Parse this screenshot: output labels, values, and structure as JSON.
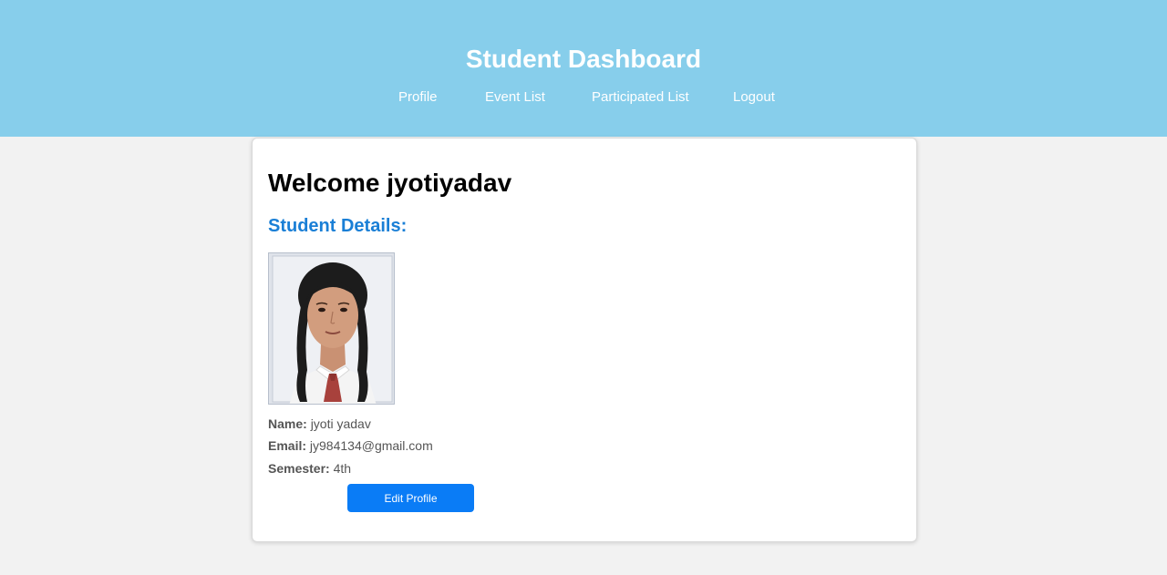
{
  "header": {
    "title": "Student Dashboard",
    "nav": [
      {
        "label": "Profile"
      },
      {
        "label": "Event List"
      },
      {
        "label": "Participated List"
      },
      {
        "label": "Logout"
      }
    ]
  },
  "main": {
    "welcome": "Welcome jyotiyadav",
    "details_heading": "Student Details:",
    "fields": [
      {
        "label": "Name:",
        "value": "jyoti yadav"
      },
      {
        "label": "Email:",
        "value": "jy984134@gmail.com"
      },
      {
        "label": "Semester:",
        "value": "4th"
      }
    ],
    "edit_button": "Edit Profile"
  },
  "colors": {
    "header_bg": "#87ceeb",
    "accent_heading": "#1a7fd6",
    "button_bg": "#0a7cf6"
  }
}
